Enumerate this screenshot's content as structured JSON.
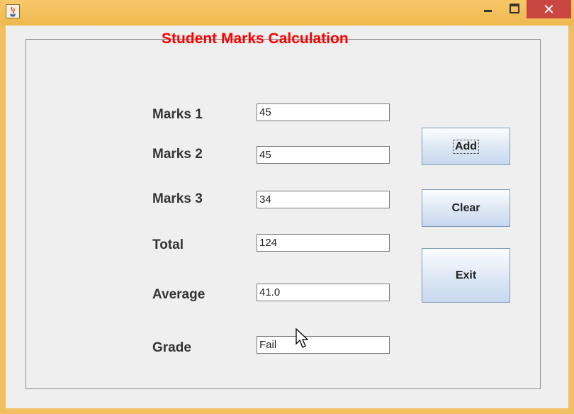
{
  "window": {
    "close_glyph": "✕"
  },
  "app": {
    "title": "Student Marks Calculation",
    "fields": [
      {
        "label": "Marks 1",
        "value": "45"
      },
      {
        "label": "Marks 2",
        "value": "45"
      },
      {
        "label": "Marks 3",
        "value": "34"
      },
      {
        "label": "Total",
        "value": "124"
      },
      {
        "label": "Average",
        "value": "41.0"
      },
      {
        "label": "Grade",
        "value": "Fail"
      }
    ],
    "buttons": {
      "add": "Add",
      "clear": "Clear",
      "exit": "Exit"
    }
  },
  "colors": {
    "title": "#ff0000",
    "titlebar": "#f0c060",
    "close_button": "#c94740"
  }
}
